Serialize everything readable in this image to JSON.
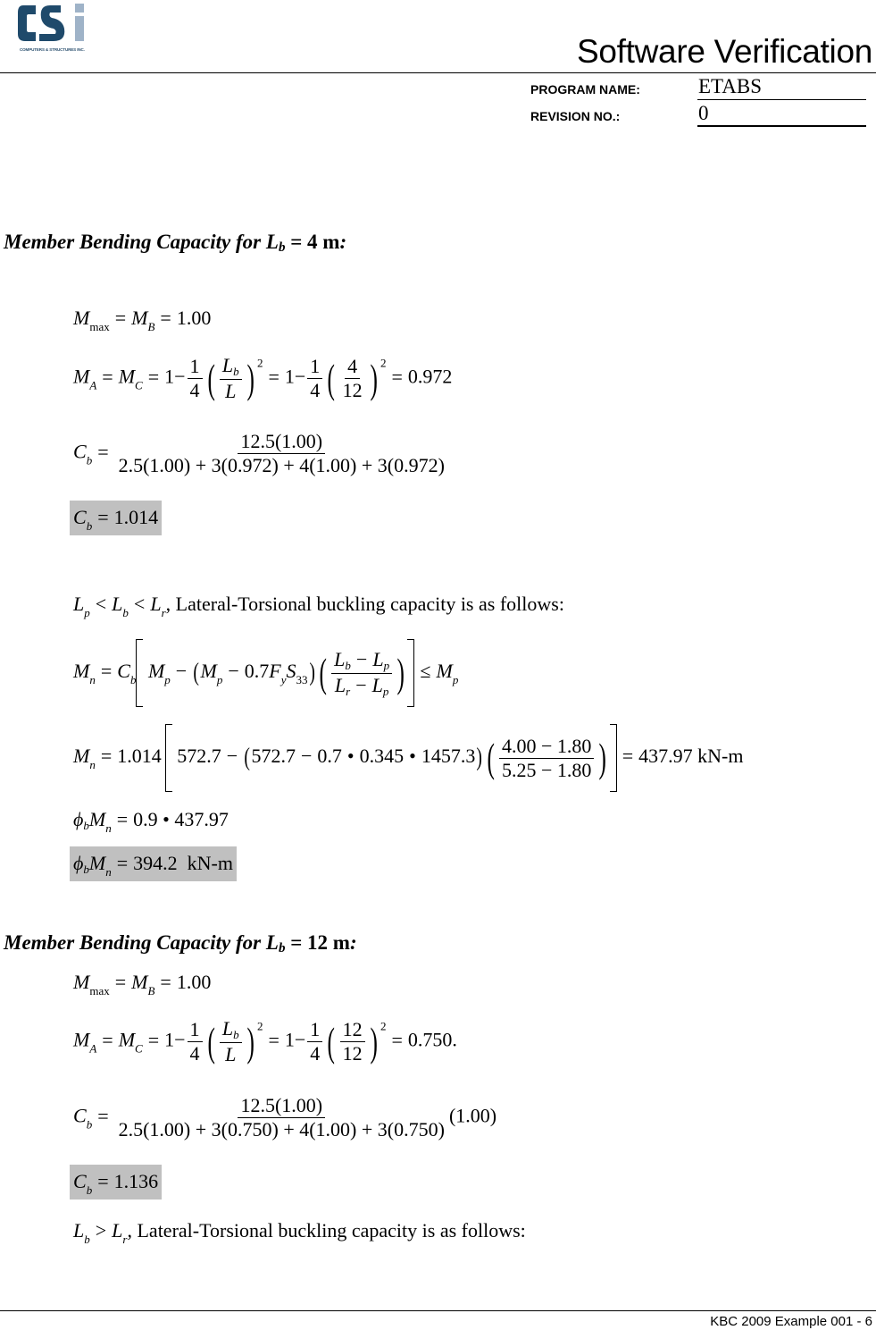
{
  "header": {
    "logo_text": "CSi",
    "logo_caption": "COMPUTERS & STRUCTURES INC.",
    "doc_title": "Software Verification",
    "program_name_label": "PROGRAM NAME:",
    "program_name_value": "ETABS",
    "revision_label": "REVISION NO.:",
    "revision_value": "0",
    "colors": {
      "logo_dark": "#1f4a6b",
      "logo_light": "#9fb3c8"
    }
  },
  "section1": {
    "heading_prefix": "Member Bending Capacity for L",
    "heading_sub": "b",
    "heading_suffix": " = 4 m",
    "heading_colon": ":",
    "mmax": {
      "lhs": "M",
      "lhs_sub": "max",
      "mid": "M",
      "mid_sub": "B",
      "value": "1.00"
    },
    "ma": {
      "m1": "M",
      "s1": "A",
      "m2": "M",
      "s2": "C",
      "one": "1",
      "quarter_num": "1",
      "quarter_den": "4",
      "lb": "L",
      "lb_sub": "b",
      "l": "L",
      "sq": "2",
      "num_val": "4",
      "den_val": "12",
      "result": "0.972",
      "trail": ""
    },
    "cb_formula": {
      "lhs": "C",
      "lhs_sub": "b",
      "numerator": "12.5(1.00)",
      "denominator": "2.5(1.00) + 3(0.972) + 4(1.00) + 3(0.972)",
      "tail": ""
    },
    "cb_result": {
      "lhs": "C",
      "lhs_sub": "b",
      "value": "1.014"
    },
    "condition": {
      "a": "L",
      "a_sub": "p",
      "b": "L",
      "b_sub": "b",
      "c": "L",
      "c_sub": "r",
      "op1": "<",
      "op2": "<",
      "text": ", Lateral-Torsional buckling capacity is as follows:"
    },
    "mn_formula": {
      "lhs": "M",
      "lhs_sub": "n",
      "cb": "C",
      "cb_sub": "b",
      "mp": "M",
      "mp_sub": "p",
      "coef": "0.7",
      "fy": "F",
      "fy_sub": "y",
      "s": "S",
      "s_sub": "33",
      "num_a": "L",
      "num_a_sub": "b",
      "num_b": "L",
      "num_b_sub": "p",
      "den_a": "L",
      "den_a_sub": "r",
      "den_b": "L",
      "den_b_sub": "p",
      "leq": "≤",
      "rhs": "M",
      "rhs_sub": "p"
    },
    "mn_numeric": {
      "lhs": "M",
      "lhs_sub": "n",
      "cb": "1.014",
      "mp": "572.7",
      "mp2": "572.7",
      "coef": "0.7",
      "fy": "0.345",
      "s33": "1457.3",
      "num": "4.00 − 1.80",
      "den": "5.25 − 1.80",
      "result": "437.97",
      "unit": "kN-m"
    },
    "phi_calc": {
      "phi": "ϕ",
      "phi_sub": "b",
      "m": "M",
      "m_sub": "n",
      "expr": "0.9 • 437.97"
    },
    "phi_result": {
      "phi": "ϕ",
      "phi_sub": "b",
      "m": "M",
      "m_sub": "n",
      "value": "394.2",
      "unit": "kN-m"
    }
  },
  "section2": {
    "heading_prefix": "Member Bending Capacity for L",
    "heading_sub": "b",
    "heading_suffix": " = 12 m",
    "heading_colon": ":",
    "mmax": {
      "lhs": "M",
      "lhs_sub": "max",
      "mid": "M",
      "mid_sub": "B",
      "value": "1.00"
    },
    "ma": {
      "m1": "M",
      "s1": "A",
      "m2": "M",
      "s2": "C",
      "one": "1",
      "quarter_num": "1",
      "quarter_den": "4",
      "lb": "L",
      "lb_sub": "b",
      "l": "L",
      "sq": "2",
      "num_val": "12",
      "den_val": "12",
      "result": "0.750",
      "trail": "."
    },
    "cb_formula": {
      "lhs": "C",
      "lhs_sub": "b",
      "numerator": "12.5(1.00)",
      "denominator": "2.5(1.00) + 3(0.750) + 4(1.00) + 3(0.750)",
      "tail": "(1.00)"
    },
    "cb_result": {
      "lhs": "C",
      "lhs_sub": "b",
      "value": "1.136"
    },
    "condition": {
      "a": "L",
      "a_sub": "b",
      "op1": ">",
      "b": "L",
      "b_sub": "r",
      "text": ", Lateral-Torsional buckling capacity is as follows:"
    }
  },
  "footer": {
    "text": "KBC 2009 Example 001 - 6"
  }
}
